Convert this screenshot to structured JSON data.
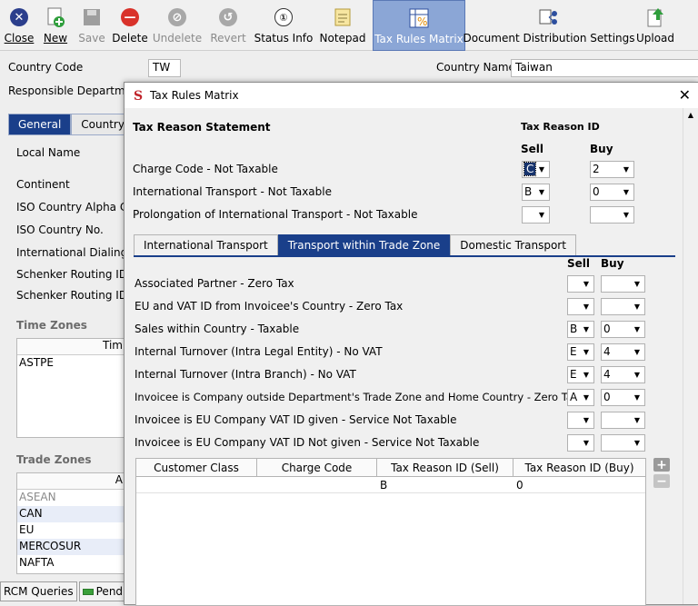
{
  "toolbar": {
    "close": "Close",
    "new": "New",
    "save": "Save",
    "delete": "Delete",
    "undelete": "Undelete",
    "revert": "Revert",
    "status_info": "Status Info",
    "notepad": "Notepad",
    "tax_rules_matrix": "Tax Rules Matrix",
    "document_distribution": "Document Distribution Settings",
    "upload": "Upload"
  },
  "form": {
    "country_code_label": "Country Code",
    "country_code_value": "TW",
    "country_name_label": "Country Name",
    "country_name_value": "Taiwan",
    "responsible_dept_label": "Responsible Departmen",
    "tabs": [
      "General",
      "Country S"
    ],
    "fields": [
      "Local Name",
      "Continent",
      "ISO Country Alpha Co",
      "ISO Country No.",
      "International Dialing P",
      "Schenker Routing ID",
      "Schenker Routing ID"
    ],
    "time_zones_title": "Time Zones",
    "time_zones_header": "Tim",
    "time_zones": [
      "ASTPE"
    ],
    "trade_zones_title": "Trade Zones",
    "trade_zones_header": "A",
    "trade_zones": [
      "ASEAN",
      "CAN",
      "EU",
      "MERCOSUR",
      "NAFTA"
    ],
    "bottom_tabs": [
      "RCM Queries",
      "Pending"
    ]
  },
  "dialog": {
    "title": "Tax Rules Matrix",
    "statement_header": "Tax Reason Statement",
    "id_header": "Tax Reason ID",
    "sell": "Sell",
    "buy": "Buy",
    "top_rows": [
      {
        "label": "Charge Code - Not Taxable",
        "sell": "C",
        "buy": "2"
      },
      {
        "label": "International Transport - Not Taxable",
        "sell": "B",
        "buy": "0"
      },
      {
        "label": "Prolongation of International Transport - Not Taxable",
        "sell": "",
        "buy": ""
      }
    ],
    "tabs": [
      "International Transport",
      "Transport within Trade Zone",
      "Domestic Transport"
    ],
    "rows": [
      {
        "label": "Associated Partner - Zero Tax",
        "sell": "",
        "buy": ""
      },
      {
        "label": "EU and VAT ID from Invoicee's Country - Zero Tax",
        "sell": "",
        "buy": ""
      },
      {
        "label": "Sales within Country - Taxable",
        "sell": "B",
        "buy": "0"
      },
      {
        "label": "Internal Turnover (Intra Legal Entity) - No VAT",
        "sell": "E",
        "buy": "4"
      },
      {
        "label": "Internal Turnover (Intra Branch) - No VAT",
        "sell": "E",
        "buy": "4"
      },
      {
        "label": "Invoicee is Company outside Department's Trade Zone and Home Country - Zero Tax",
        "sell": "A",
        "buy": "0"
      },
      {
        "label": "Invoicee is EU Company VAT ID given - Service Not Taxable",
        "sell": "",
        "buy": ""
      },
      {
        "label": "Invoicee is EU Company VAT ID Not given - Service Not Taxable",
        "sell": "",
        "buy": ""
      }
    ],
    "grid_headers": [
      "Customer Class",
      "Charge Code",
      "Tax Reason ID (Sell)",
      "Tax Reason ID (Buy)"
    ],
    "grid_rows": [
      [
        "",
        "",
        "B",
        "0"
      ]
    ]
  }
}
